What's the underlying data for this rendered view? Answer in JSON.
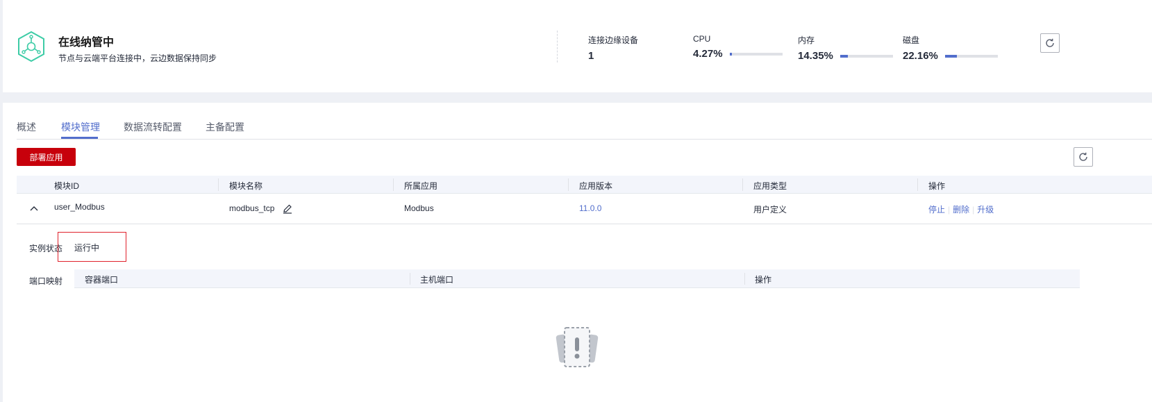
{
  "status": {
    "title": "在线纳管中",
    "description": "节点与云端平台连接中，云边数据保持同步",
    "metrics": [
      {
        "label": "连接边缘设备",
        "value": "1"
      },
      {
        "label": "CPU",
        "value": "4.27%",
        "percent": 4.27
      },
      {
        "label": "内存",
        "value": "14.35%",
        "percent": 14.35
      },
      {
        "label": "磁盘",
        "value": "22.16%",
        "percent": 22.16
      }
    ],
    "accent_color": "#526ecc",
    "logo_color": "#3dcca6"
  },
  "tabs": [
    {
      "label": "概述"
    },
    {
      "label": "模块管理",
      "active": true
    },
    {
      "label": "数据流转配置"
    },
    {
      "label": "主备配置"
    }
  ],
  "toolbar": {
    "deploy_label": "部署应用",
    "deploy_color": "#c7000b"
  },
  "table": {
    "headers": [
      "模块ID",
      "模块名称",
      "所属应用",
      "应用版本",
      "应用类型",
      "操作"
    ],
    "rows": [
      {
        "module_id": "user_Modbus",
        "module_name": "modbus_tcp",
        "application": "Modbus",
        "version": "11.0.0",
        "type": "用户定义",
        "actions": [
          "停止",
          "删除",
          "升级"
        ]
      }
    ]
  },
  "detail": {
    "instance_state_label": "实例状态",
    "instance_state_value": "运行中",
    "port_mapping_label": "端口映射",
    "port_headers": [
      "容器端口",
      "主机端口",
      "操作"
    ]
  },
  "icons": {
    "logo": "node-hex-icon",
    "refresh": "refresh-icon",
    "expand": "chevron-up-icon",
    "edit": "pencil-icon",
    "empty": "empty-data-icon"
  }
}
